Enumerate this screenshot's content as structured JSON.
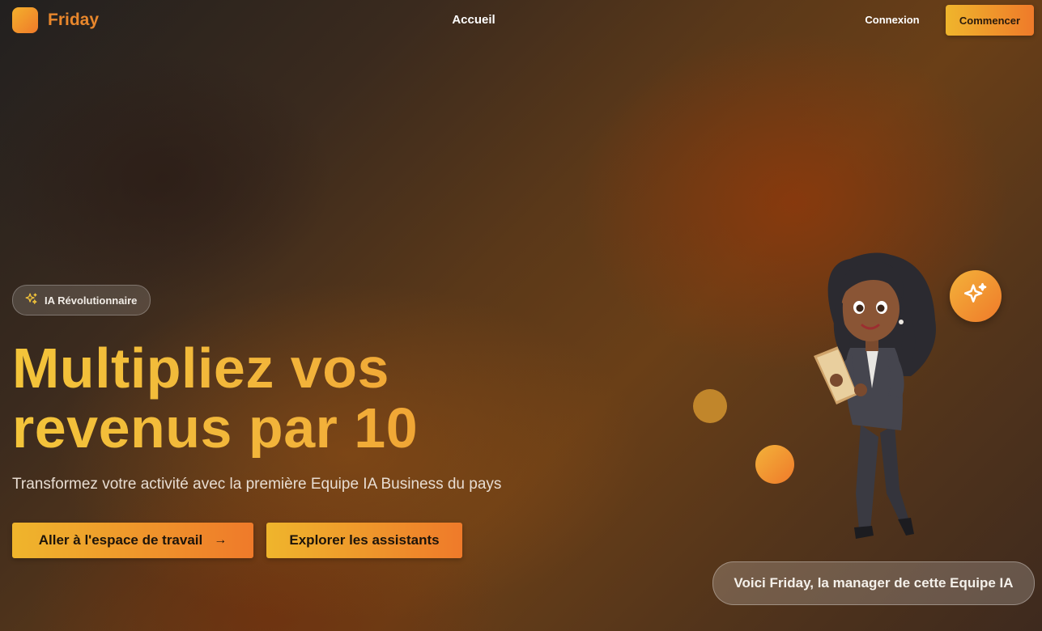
{
  "nav": {
    "brand": "Friday",
    "links": [
      {
        "label": "Accueil"
      }
    ],
    "login_label": "Connexion",
    "cta_label": "Commencer"
  },
  "hero": {
    "badge_label": "IA Révolutionnaire",
    "badge_icon": "sparkles-icon",
    "headline_line1": "Multipliez vos",
    "headline_line2": "revenus par 10",
    "subtitle": "Transformez votre activité avec la première Equipe IA Business du pays",
    "primary_button": {
      "label": "Aller à l'espace de travail",
      "icon": "arrow-right-icon",
      "icon_glyph": "→"
    },
    "secondary_button": {
      "label": "Explorer les assistants"
    }
  },
  "illustration": {
    "caption": "Voici Friday, la manager de cette Equipe IA",
    "accent_icon": "sparkles-icon"
  },
  "colors": {
    "accent_start": "#efb52c",
    "accent_end": "#ef7a2a",
    "brand_text": "#e9872c",
    "headline": "#f3c43a"
  }
}
